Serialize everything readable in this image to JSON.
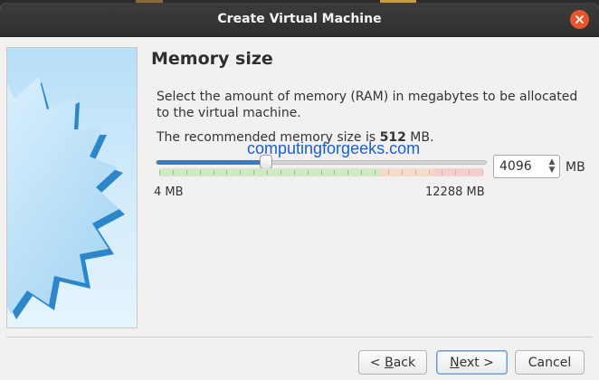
{
  "window": {
    "title": "Create Virtual Machine"
  },
  "page": {
    "heading": "Memory size",
    "description": "Select the amount of memory (RAM) in megabytes to be allocated to the virtual machine.",
    "recommend_prefix": "The recommended memory size is ",
    "recommend_value": "512",
    "recommend_suffix": " MB."
  },
  "watermark": "computingforgeeks.com",
  "memory": {
    "value": "4096",
    "unit": "MB",
    "min_label": "4 MB",
    "max_label": "12288 MB",
    "min": 4,
    "max": 12288,
    "current": 4096
  },
  "buttons": {
    "back_prefix": "< ",
    "back_mnemonic": "B",
    "back_rest": "ack",
    "next_mnemonic": "N",
    "next_rest": "ext >",
    "cancel": "Cancel"
  },
  "colors": {
    "accent": "#3d7bbf",
    "close": "#e9542c",
    "titlebar": "#302f2d"
  },
  "icons": [
    "close-icon",
    "spin-up-icon",
    "spin-down-icon",
    "virtualbox-star-graphic"
  ]
}
